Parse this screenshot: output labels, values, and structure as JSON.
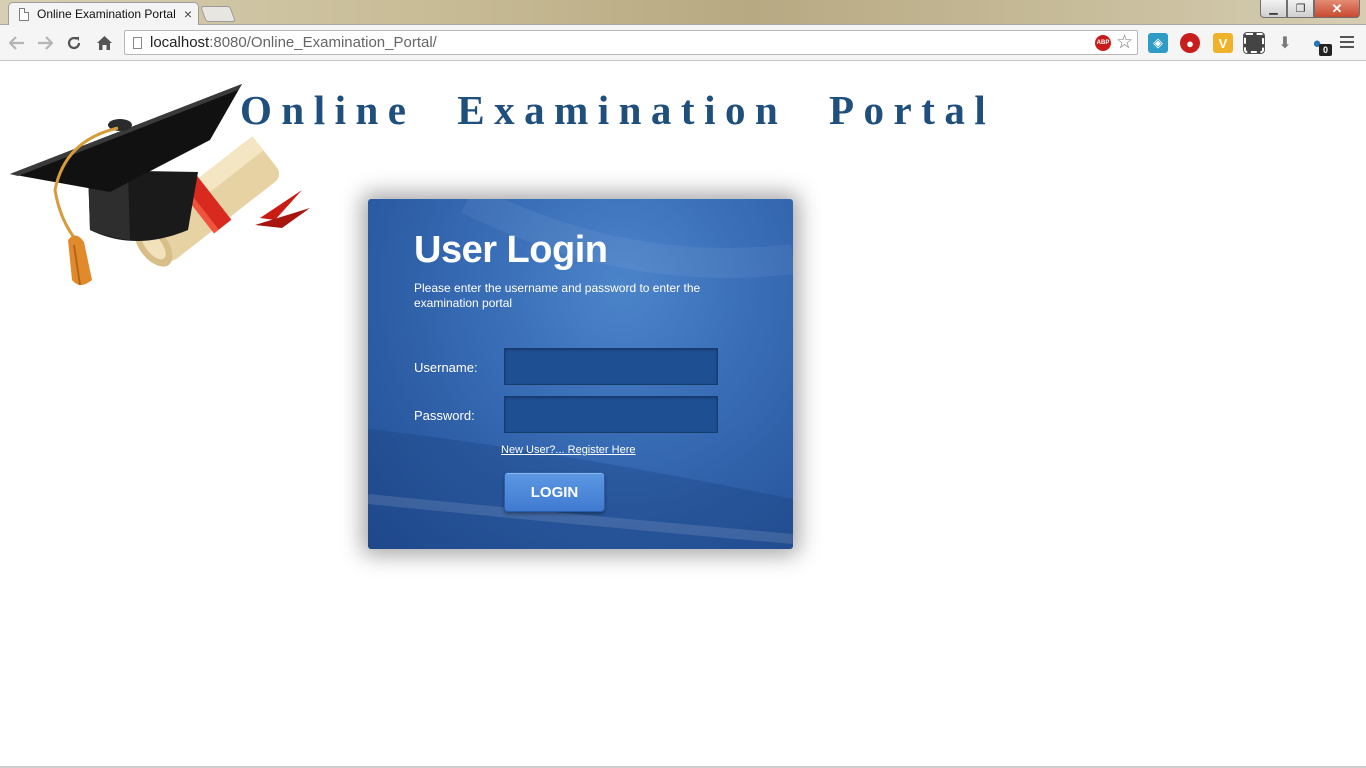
{
  "browser": {
    "tab_title": "Online Examination Portal",
    "tab_close": "×",
    "url_host": "localhost",
    "url_rest": ":8080/Online_Examination_Portal/",
    "abp_label": "ABP",
    "extension_badge": "0",
    "window_controls": {
      "minimize": "▁",
      "restore": "❐",
      "close": "✕"
    }
  },
  "page": {
    "site_title": "Online Examination Portal",
    "login": {
      "heading": "User Login",
      "description": "Please enter the username and password to enter the examination portal",
      "username_label": "Username:",
      "password_label": "Password:",
      "username_value": "",
      "password_value": "",
      "register_link": "New User?... Register Here",
      "login_button": "LOGIN"
    }
  },
  "colors": {
    "title": "#1f4f7d",
    "login_panel": "#2d5ea6",
    "login_button": "#4a88da"
  },
  "icons": {
    "back": "back-arrow-icon",
    "forward": "forward-arrow-icon",
    "reload": "reload-icon",
    "home": "home-icon",
    "star": "bookmark-star-icon",
    "menu": "hamburger-menu-icon",
    "logo": "graduation-cap-diploma-icon"
  }
}
